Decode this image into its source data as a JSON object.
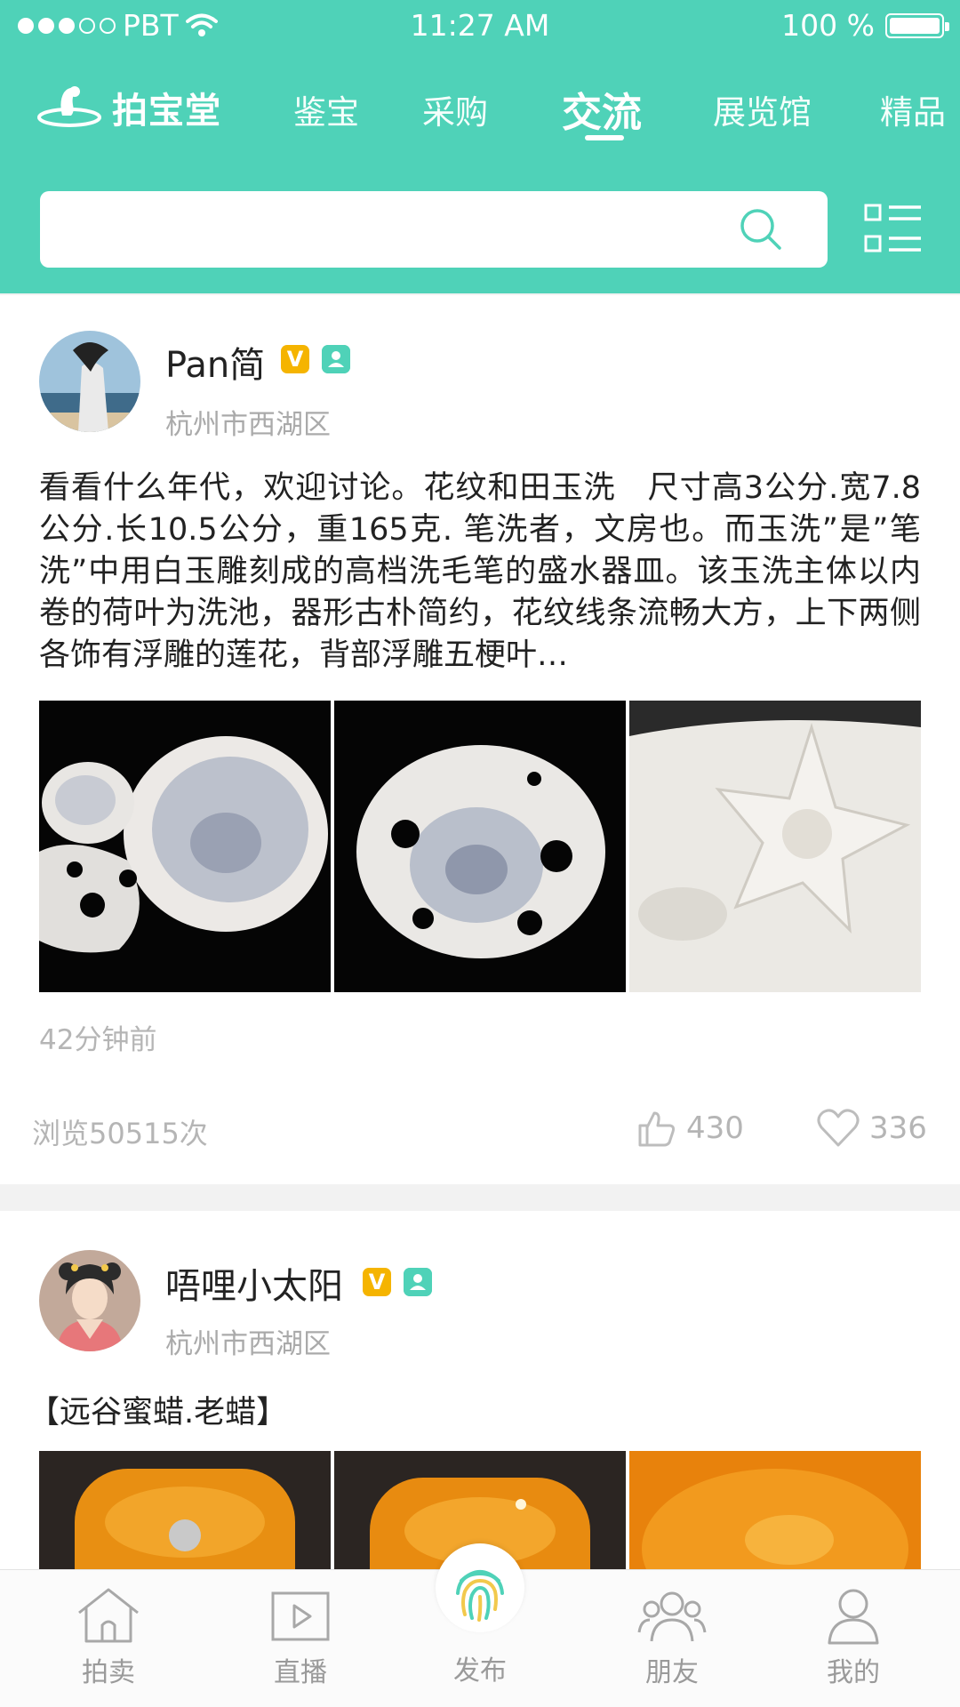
{
  "status_bar": {
    "carrier": "PBT",
    "time": "11:27 AM",
    "battery": "100 %"
  },
  "header": {
    "logo_text": "拍宝堂",
    "tabs": [
      {
        "label": "鉴宝"
      },
      {
        "label": "采购"
      },
      {
        "label": "交流",
        "active": true
      },
      {
        "label": "展览馆"
      },
      {
        "label": "精品"
      }
    ],
    "search": {
      "placeholder": ""
    }
  },
  "posts": [
    {
      "username": "Pan简",
      "location": "杭州市西湖区",
      "content": "看看什么年代，欢迎讨论。花纹和田玉洗　尺寸高3公分.宽7.8公分.长10.5公分，重165克. 笔洗者，文房也。而玉洗”是”笔洗”中用白玉雕刻成的高档洗毛笔的盛水器皿。该玉洗主体以内卷的荷叶为洗池，器形古朴简约，花纹线条流畅大方，上下两侧各饰有浮雕的莲花，背部浮雕五梗叶…",
      "time_ago": "42分钟前",
      "views": "浏览50515次",
      "likes": "430",
      "favorites": "336"
    },
    {
      "username": "唔哩小太阳",
      "location": "杭州市西湖区",
      "content": "【远谷蜜蜡.老蜡】"
    }
  ],
  "tabbar": {
    "items": [
      {
        "label": "拍卖",
        "icon": "house-icon"
      },
      {
        "label": "直播",
        "icon": "play-icon"
      },
      {
        "label": "发布",
        "icon": "fingerprint-icon"
      },
      {
        "label": "朋友",
        "icon": "friends-icon"
      },
      {
        "label": "我的",
        "icon": "user-icon"
      }
    ]
  },
  "colors": {
    "accent": "#4fd2b8",
    "vip": "#f5b400",
    "muted": "#b5b5b5"
  }
}
